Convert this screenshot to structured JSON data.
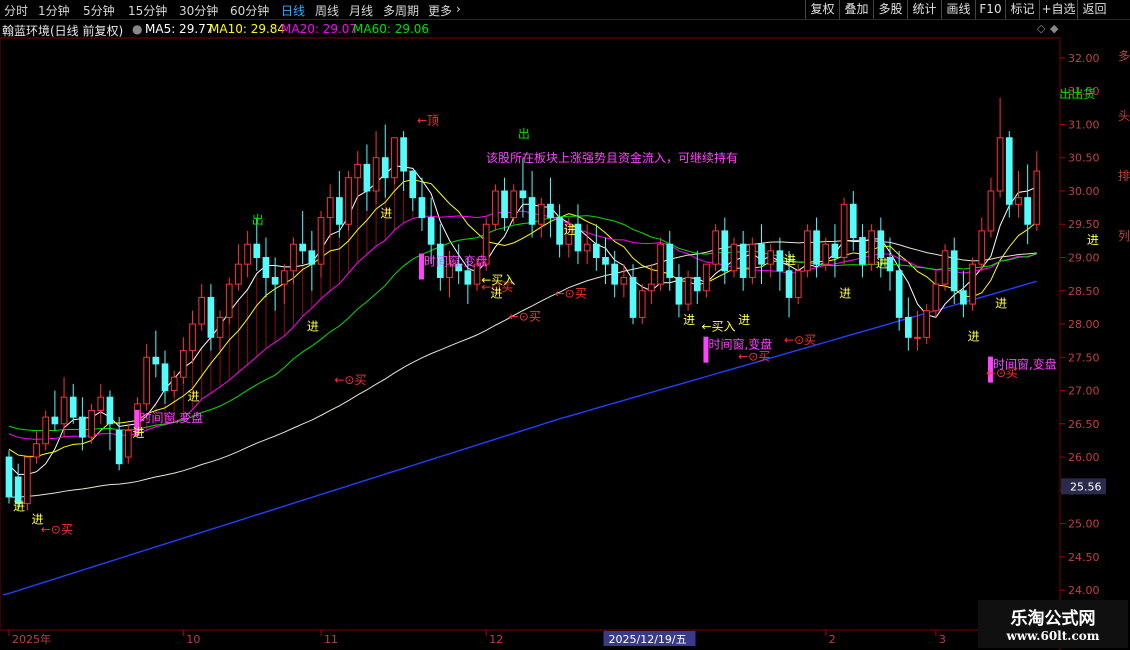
{
  "toolbar": {
    "periods": [
      "分时",
      "1分钟",
      "5分钟",
      "15分钟",
      "30分钟",
      "60分钟",
      "日线",
      "周线",
      "月线",
      "多周期",
      "更多"
    ],
    "active_period": "日线",
    "buttons": [
      "复权",
      "叠加",
      "多股",
      "统计",
      "画线",
      "F10",
      "标记",
      "+自选",
      "返回"
    ]
  },
  "info": {
    "stock": "翰蓝环境(日线 前复权)",
    "ma5": "MA5: 29.77",
    "ma10": "MA10: 29.84",
    "ma20": "MA20: 29.07",
    "ma60": "MA60: 29.06"
  },
  "watermark": {
    "line1": "乐淘公式网",
    "line2": "www.60lt.com"
  },
  "colors": {
    "up": "#ff3232",
    "down": "#54fcfc",
    "ma5": "#ffffff",
    "ma10": "#ffff00",
    "ma20": "#ff00ff",
    "ma60": "#00e000",
    "long_ma": "#2040ff",
    "signal": "#ff44ff",
    "enter": "#ffff40",
    "buy": "#ff3030"
  },
  "chart_data": {
    "type": "candlestick",
    "y_ticks": [
      "23.50",
      "24.00",
      "24.50",
      "25.00",
      "25.50",
      "26.00",
      "26.50",
      "27.00",
      "27.50",
      "28.00",
      "28.50",
      "29.00",
      "29.50",
      "30.00",
      "30.50",
      "31.00",
      "31.50",
      "32.00"
    ],
    "ylim": [
      23.4,
      32.3
    ],
    "current_price": "25.56",
    "x_labels": [
      {
        "label": "2025年",
        "i": 0
      },
      {
        "label": "10",
        "i": 19
      },
      {
        "label": "11",
        "i": 34
      },
      {
        "label": "12",
        "i": 52
      },
      {
        "label": "2025/12/19/五",
        "i": 65
      },
      {
        "label": "2",
        "i": 89
      },
      {
        "label": "3",
        "i": 101
      }
    ],
    "candles": [
      [
        26.0,
        26.1,
        25.4,
        25.3
      ],
      [
        25.7,
        25.9,
        25.3,
        25.2
      ],
      [
        25.3,
        26.0,
        26.0,
        25.2
      ],
      [
        26.0,
        26.4,
        26.2,
        25.9
      ],
      [
        26.2,
        26.7,
        26.6,
        26.1
      ],
      [
        26.6,
        27.0,
        26.5,
        26.4
      ],
      [
        26.5,
        27.2,
        26.9,
        26.3
      ],
      [
        26.9,
        27.1,
        26.6,
        26.5
      ],
      [
        26.6,
        26.9,
        26.3,
        26.1
      ],
      [
        26.3,
        26.8,
        26.7,
        26.2
      ],
      [
        26.7,
        27.1,
        26.9,
        26.5
      ],
      [
        26.9,
        27.0,
        26.5,
        26.1
      ],
      [
        26.4,
        26.6,
        25.9,
        25.8
      ],
      [
        26.0,
        26.5,
        26.4,
        25.9
      ],
      [
        26.4,
        26.9,
        26.8,
        26.3
      ],
      [
        26.8,
        27.7,
        27.5,
        26.7
      ],
      [
        27.5,
        27.9,
        27.4,
        27.2
      ],
      [
        27.4,
        27.6,
        27.0,
        26.8
      ],
      [
        27.0,
        27.3,
        27.2,
        26.9
      ],
      [
        27.2,
        27.8,
        27.6,
        27.1
      ],
      [
        27.6,
        28.2,
        28.0,
        27.4
      ],
      [
        28.0,
        28.6,
        28.4,
        27.9
      ],
      [
        28.4,
        28.6,
        27.8,
        27.6
      ],
      [
        27.8,
        28.2,
        28.1,
        27.6
      ],
      [
        28.1,
        28.7,
        28.6,
        28.0
      ],
      [
        28.6,
        29.2,
        28.9,
        28.5
      ],
      [
        28.9,
        29.4,
        29.2,
        28.7
      ],
      [
        29.2,
        29.6,
        29.0,
        28.8
      ],
      [
        29.0,
        29.3,
        28.7,
        28.4
      ],
      [
        28.7,
        29.0,
        28.6,
        28.2
      ],
      [
        28.6,
        28.9,
        28.8,
        28.3
      ],
      [
        28.8,
        29.3,
        29.2,
        28.6
      ],
      [
        29.2,
        29.7,
        29.1,
        28.9
      ],
      [
        29.1,
        29.4,
        28.9,
        28.5
      ],
      [
        28.9,
        29.7,
        29.6,
        28.7
      ],
      [
        29.6,
        30.1,
        29.9,
        29.3
      ],
      [
        29.9,
        30.3,
        29.5,
        29.3
      ],
      [
        29.5,
        30.3,
        30.2,
        29.4
      ],
      [
        30.2,
        30.6,
        30.4,
        29.9
      ],
      [
        30.4,
        30.7,
        30.0,
        29.7
      ],
      [
        30.0,
        30.9,
        30.5,
        29.8
      ],
      [
        30.5,
        31.0,
        30.2,
        29.9
      ],
      [
        30.2,
        30.8,
        30.8,
        30.1
      ],
      [
        30.8,
        30.9,
        30.3,
        30.0
      ],
      [
        30.3,
        30.3,
        29.9,
        29.7
      ],
      [
        29.9,
        30.2,
        29.6,
        29.4
      ],
      [
        29.6,
        29.9,
        29.2,
        28.9
      ],
      [
        29.2,
        29.5,
        28.7,
        28.5
      ],
      [
        28.7,
        29.1,
        28.9,
        28.4
      ],
      [
        28.9,
        29.2,
        28.8,
        28.6
      ],
      [
        28.8,
        29.0,
        28.6,
        28.3
      ],
      [
        28.6,
        29.0,
        28.9,
        28.5
      ],
      [
        28.9,
        29.6,
        29.5,
        28.8
      ],
      [
        29.5,
        30.1,
        30.0,
        29.4
      ],
      [
        30.0,
        30.2,
        29.6,
        29.4
      ],
      [
        29.6,
        30.1,
        30.0,
        29.5
      ],
      [
        30.0,
        30.5,
        29.9,
        29.6
      ],
      [
        29.9,
        30.3,
        29.5,
        29.3
      ],
      [
        29.5,
        29.9,
        29.8,
        29.3
      ],
      [
        29.8,
        30.2,
        29.6,
        29.3
      ],
      [
        29.6,
        29.8,
        29.2,
        29.0
      ],
      [
        29.2,
        29.6,
        29.5,
        29.0
      ],
      [
        29.5,
        29.8,
        29.1,
        28.9
      ],
      [
        29.1,
        29.5,
        29.2,
        28.9
      ],
      [
        29.2,
        29.5,
        29.0,
        28.8
      ],
      [
        29.0,
        29.3,
        28.9,
        28.6
      ],
      [
        28.9,
        29.1,
        28.6,
        28.4
      ],
      [
        28.6,
        28.9,
        28.7,
        28.4
      ],
      [
        28.7,
        28.9,
        28.1,
        28.0
      ],
      [
        28.1,
        28.6,
        28.5,
        28.0
      ],
      [
        28.5,
        28.9,
        28.6,
        28.3
      ],
      [
        28.6,
        29.3,
        29.2,
        28.5
      ],
      [
        29.2,
        29.4,
        28.7,
        28.5
      ],
      [
        28.7,
        28.9,
        28.3,
        28.1
      ],
      [
        28.3,
        28.8,
        28.7,
        28.2
      ],
      [
        28.7,
        29.1,
        28.5,
        28.3
      ],
      [
        28.5,
        28.9,
        28.9,
        28.4
      ],
      [
        28.9,
        29.5,
        29.4,
        28.8
      ],
      [
        29.4,
        29.6,
        28.8,
        28.6
      ],
      [
        28.8,
        29.3,
        29.2,
        28.7
      ],
      [
        29.2,
        29.4,
        28.7,
        28.5
      ],
      [
        28.7,
        29.3,
        29.2,
        28.6
      ],
      [
        29.2,
        29.5,
        28.9,
        28.6
      ],
      [
        28.9,
        29.2,
        29.1,
        28.7
      ],
      [
        29.1,
        29.3,
        28.8,
        28.5
      ],
      [
        28.8,
        29.1,
        28.4,
        28.1
      ],
      [
        28.4,
        28.9,
        28.8,
        28.3
      ],
      [
        28.8,
        29.5,
        29.4,
        28.7
      ],
      [
        29.4,
        29.6,
        28.9,
        28.7
      ],
      [
        28.9,
        29.3,
        29.2,
        28.8
      ],
      [
        29.2,
        29.5,
        29.0,
        28.7
      ],
      [
        29.0,
        29.9,
        29.8,
        28.9
      ],
      [
        29.8,
        30.0,
        29.3,
        29.1
      ],
      [
        29.3,
        29.5,
        28.9,
        28.7
      ],
      [
        28.9,
        29.5,
        29.4,
        28.8
      ],
      [
        29.4,
        29.6,
        29.0,
        28.7
      ],
      [
        29.0,
        29.3,
        28.8,
        28.5
      ],
      [
        28.8,
        29.1,
        28.1,
        27.9
      ],
      [
        28.1,
        28.4,
        27.8,
        27.6
      ],
      [
        27.8,
        28.2,
        27.8,
        27.6
      ],
      [
        27.8,
        28.3,
        28.2,
        27.7
      ],
      [
        28.2,
        28.8,
        28.6,
        28.1
      ],
      [
        28.6,
        29.2,
        29.1,
        28.5
      ],
      [
        29.1,
        29.3,
        28.5,
        28.3
      ],
      [
        28.5,
        28.8,
        28.3,
        28.1
      ],
      [
        28.3,
        29.0,
        28.9,
        28.2
      ],
      [
        28.9,
        29.6,
        29.4,
        28.8
      ],
      [
        29.4,
        30.2,
        30.0,
        29.3
      ],
      [
        30.0,
        31.4,
        30.8,
        29.9
      ],
      [
        30.8,
        30.9,
        29.8,
        29.6
      ],
      [
        29.8,
        30.3,
        29.9,
        29.6
      ],
      [
        29.9,
        30.4,
        29.5,
        29.2
      ],
      [
        29.5,
        30.6,
        30.3,
        29.4
      ]
    ],
    "annotations": [
      {
        "text": "进",
        "i": 1,
        "p": 25.2,
        "c": "enter"
      },
      {
        "text": "进",
        "i": 3,
        "p": 25.0,
        "c": "enter"
      },
      {
        "text": "←⊙买",
        "i": 4,
        "p": 24.85,
        "c": "buy"
      },
      {
        "text": "进",
        "i": 14,
        "p": 26.3,
        "c": "enter"
      },
      {
        "text": "进",
        "i": 20,
        "p": 26.85,
        "c": "enter"
      },
      {
        "text": "出",
        "i": 27,
        "p": 29.5,
        "c": "ma60"
      },
      {
        "text": "进",
        "i": 33,
        "p": 27.9,
        "c": "enter"
      },
      {
        "text": "←⊙买",
        "i": 36,
        "p": 27.1,
        "c": "buy"
      },
      {
        "text": "进",
        "i": 41,
        "p": 29.6,
        "c": "enter"
      },
      {
        "text": "←顶",
        "i": 45,
        "p": 31.0,
        "c": "buy"
      },
      {
        "text": "←⊙买",
        "i": 52,
        "p": 28.5,
        "c": "buy"
      },
      {
        "text": "←买入",
        "i": 52,
        "p": 28.6,
        "c": "enter"
      },
      {
        "text": "进",
        "i": 53,
        "p": 28.4,
        "c": "enter"
      },
      {
        "text": "←⊙买",
        "i": 55,
        "p": 28.05,
        "c": "buy"
      },
      {
        "text": "出",
        "i": 56,
        "p": 30.8,
        "c": "ma60"
      },
      {
        "text": "进",
        "i": 61,
        "p": 29.35,
        "c": "enter"
      },
      {
        "text": "←⊙买",
        "i": 60,
        "p": 28.4,
        "c": "buy"
      },
      {
        "text": "进",
        "i": 74,
        "p": 28.0,
        "c": "enter"
      },
      {
        "text": "←买入",
        "i": 76,
        "p": 27.9,
        "c": "enter"
      },
      {
        "text": "进",
        "i": 80,
        "p": 28.0,
        "c": "enter"
      },
      {
        "text": "←⊙买",
        "i": 80,
        "p": 27.45,
        "c": "buy"
      },
      {
        "text": "←⊙买",
        "i": 85,
        "p": 27.7,
        "c": "buy"
      },
      {
        "text": "进",
        "i": 85,
        "p": 28.9,
        "c": "enter"
      },
      {
        "text": "进",
        "i": 91,
        "p": 28.4,
        "c": "enter"
      },
      {
        "text": "进",
        "i": 95,
        "p": 28.85,
        "c": "enter"
      },
      {
        "text": "进",
        "i": 105,
        "p": 27.75,
        "c": "enter"
      },
      {
        "text": "进",
        "i": 108,
        "p": 28.25,
        "c": "enter"
      },
      {
        "text": "←⊙买",
        "i": 107,
        "p": 27.2,
        "c": "buy"
      },
      {
        "text": "出出货",
        "i": 115,
        "p": 31.4,
        "c": "ma60"
      },
      {
        "text": "进",
        "i": 118,
        "p": 29.2,
        "c": "enter"
      }
    ],
    "signals": [
      {
        "text": "时间窗,变盘",
        "i": 14,
        "p": 26.65
      },
      {
        "text": "时间窗,变盘",
        "i": 45,
        "p": 29.0
      },
      {
        "text": "时间窗,变盘",
        "i": 76,
        "p": 27.75
      },
      {
        "text": "时间窗,变盘",
        "i": 107,
        "p": 27.45
      }
    ],
    "overlay_text": "该股所在板块上涨强势且资金流入，可继续持有",
    "side_text": "多头排列"
  }
}
